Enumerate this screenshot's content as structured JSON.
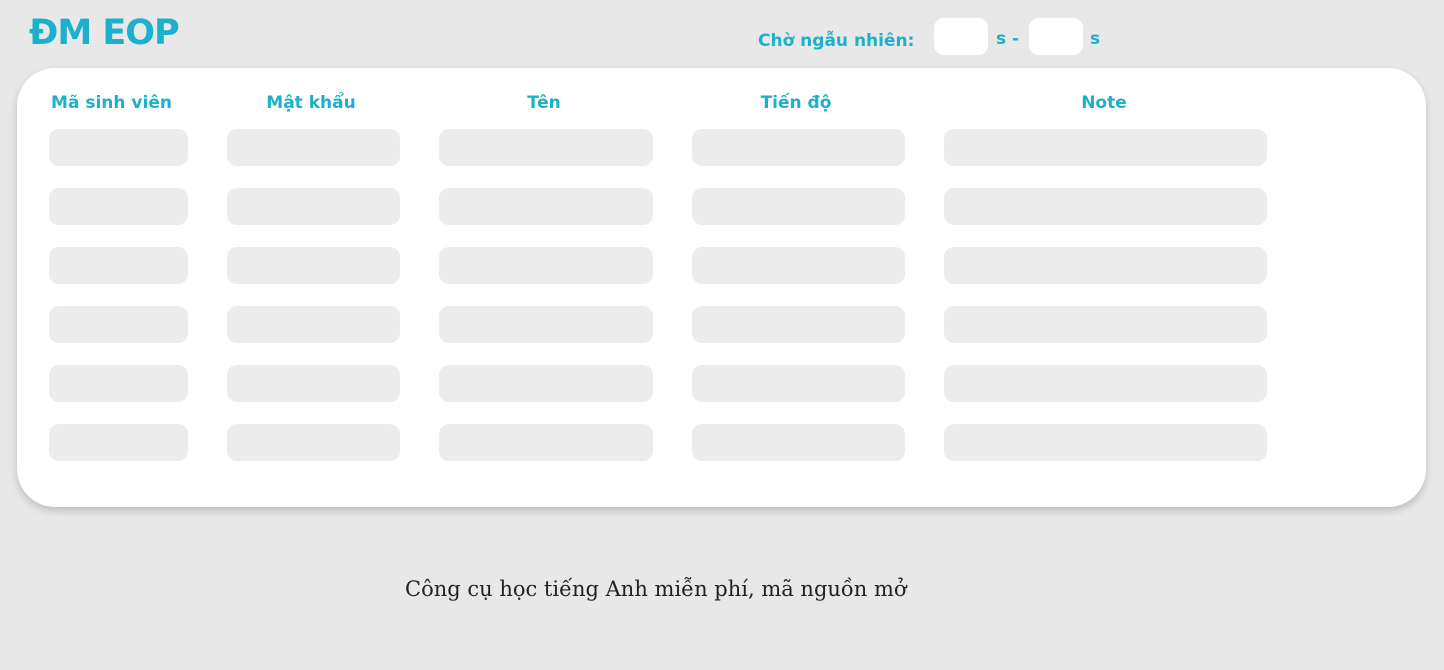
{
  "header": {
    "logo": "ĐM EOP",
    "wait_label": "Chờ ngẫu nhiên:",
    "wait_min_value": "",
    "wait_max_value": "",
    "unit_first": "s -",
    "unit_second": "s"
  },
  "table": {
    "columns": [
      "Mã sinh viên",
      "Mật khẩu",
      "Tên",
      "Tiến độ",
      "Note"
    ],
    "rows": [
      [
        "",
        "",
        "",
        "",
        ""
      ],
      [
        "",
        "",
        "",
        "",
        ""
      ],
      [
        "",
        "",
        "",
        "",
        ""
      ],
      [
        "",
        "",
        "",
        "",
        ""
      ],
      [
        "",
        "",
        "",
        "",
        ""
      ],
      [
        "",
        "",
        "",
        "",
        ""
      ]
    ]
  },
  "footer": {
    "text": "Công cụ học tiếng Anh miễn phí, mã nguồn mở"
  },
  "colors": {
    "accent": "#1db0cc",
    "background": "#e8e8e8",
    "card": "#ffffff",
    "field": "#ececec"
  }
}
